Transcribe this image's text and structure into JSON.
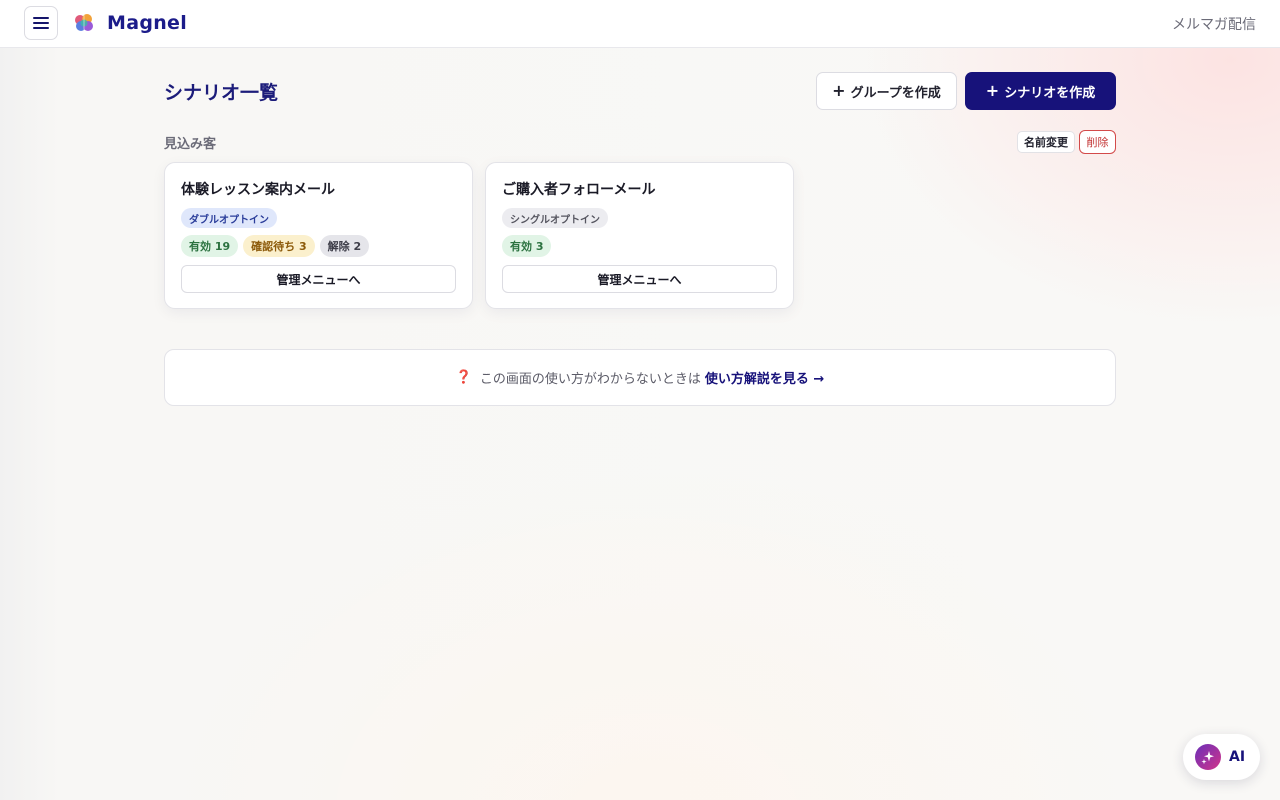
{
  "header": {
    "brand": "Magnel",
    "right_link": "メルマガ配信"
  },
  "page": {
    "title": "シナリオ一覧",
    "create_group_label": "グループを作成",
    "create_scenario_label": "シナリオを作成"
  },
  "group": {
    "name": "見込み客",
    "rename_label": "名前変更",
    "delete_label": "削除"
  },
  "cards": [
    {
      "title": "体験レッスン案内メール",
      "optin": "ダブルオプトイン",
      "stats": [
        "有効 19",
        "確認待ち 3",
        "解除 2"
      ],
      "manage_label": "管理メニューへ"
    },
    {
      "title": "ご購入者フォローメール",
      "optin": "シングルオプトイン",
      "stats": [
        "有効 3"
      ],
      "manage_label": "管理メニューへ"
    }
  ],
  "help": {
    "icon": "❓",
    "text": "この画面の使い方がわからないときは",
    "link": "使い方解説を見る →"
  },
  "ai": {
    "label": "AI"
  },
  "colors": {
    "primary": "#17127a",
    "brand_text": "#1c1c8a",
    "danger": "#c23232"
  }
}
